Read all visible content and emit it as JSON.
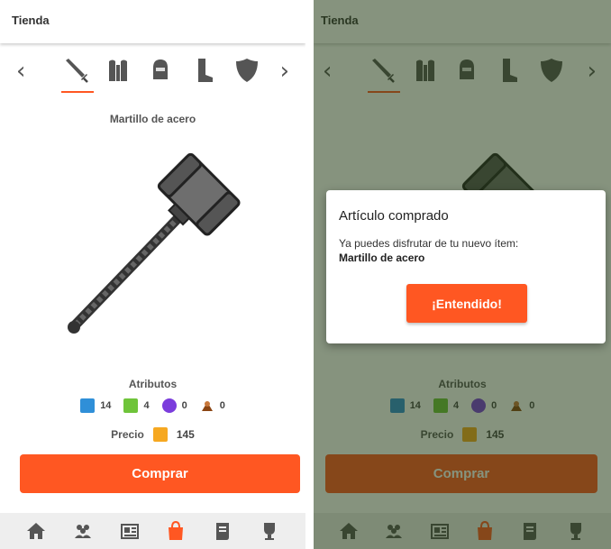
{
  "shop": {
    "title": "Tienda",
    "prev_arrow": "‹",
    "next_arrow": "›",
    "categories": [
      {
        "icon": "sword-icon",
        "active": true
      },
      {
        "icon": "armor-icon",
        "active": false
      },
      {
        "icon": "helmet-icon",
        "active": false
      },
      {
        "icon": "boot-icon",
        "active": false
      },
      {
        "icon": "shield-icon",
        "active": false
      }
    ],
    "item_name": "Martillo de acero",
    "attributes_title": "Atributos",
    "attributes": [
      {
        "icon": "attack-icon",
        "value": "14",
        "color": "#2f8fd8"
      },
      {
        "icon": "agility-icon",
        "value": "4",
        "color": "#6fc43a"
      },
      {
        "icon": "magic-icon",
        "value": "0",
        "color": "#7b3ddc"
      },
      {
        "icon": "defense-icon",
        "value": "0",
        "color": "#8b4513"
      }
    ],
    "price_label": "Precio",
    "price_value": "145",
    "buy_label": "Comprar"
  },
  "nav": [
    "home-icon",
    "group-icon",
    "news-icon",
    "shop-bag-icon",
    "scroll-icon",
    "trophy-icon"
  ],
  "dialog": {
    "title": "Artículo comprado",
    "message": "Ya puedes disfrutar de tu nuevo ítem:",
    "item": "Martillo de acero",
    "button": "¡Entendido!"
  },
  "colors": {
    "accent": "#ff5722",
    "overlay": "#22380f",
    "coin": "#f6a821",
    "nav_background": "#eeeeee"
  }
}
